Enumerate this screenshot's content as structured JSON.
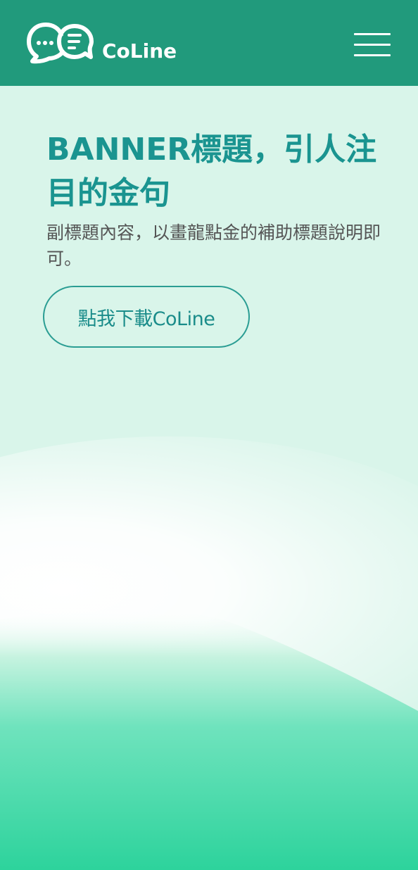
{
  "header": {
    "brand_name": "CoLine",
    "logo_icon": "chat-bubbles-icon",
    "menu_icon": "hamburger-menu-icon",
    "background_color": "#219a7c"
  },
  "banner": {
    "title": "BANNER標題，引人注目的金句",
    "subtitle": "副標題內容，以畫龍點金的補助標題說明即可。",
    "download_button_label": "點我下載CoLine",
    "title_color": "#1a9490",
    "background_color": "#d9f5ea",
    "wave_color": "#34d39f"
  }
}
